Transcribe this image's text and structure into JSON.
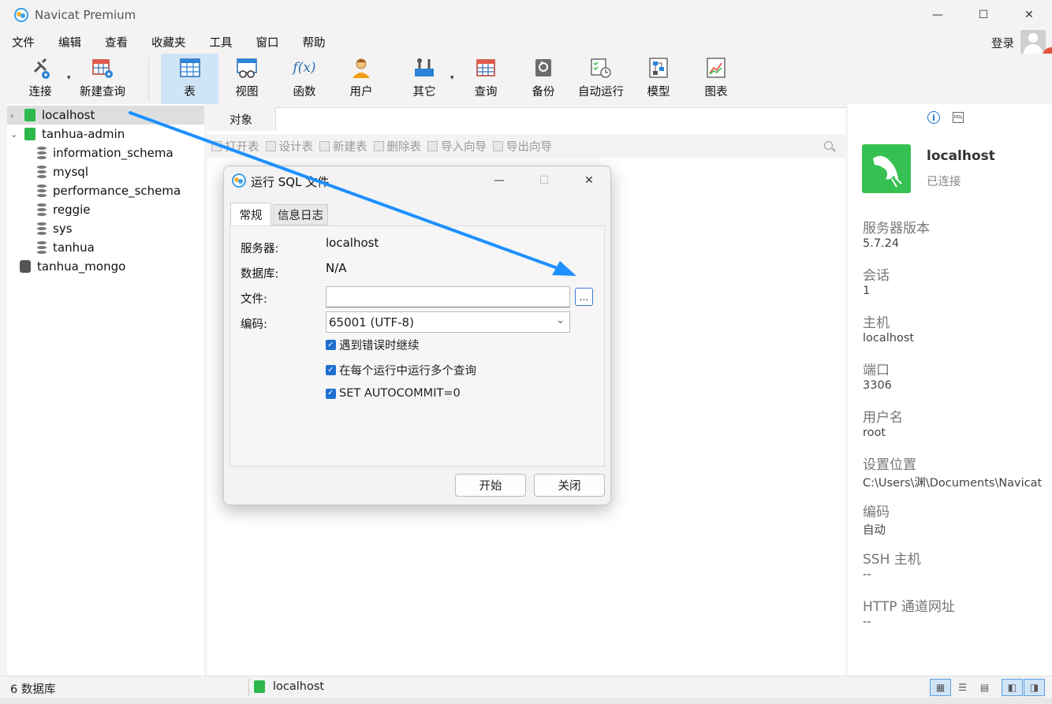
{
  "app": {
    "title": "Navicat Premium"
  },
  "window_controls": {
    "minimize": "—",
    "maximize": "☐",
    "close": "✕"
  },
  "menu": [
    "文件",
    "编辑",
    "查看",
    "收藏夹",
    "工具",
    "窗口",
    "帮助"
  ],
  "login_label": "登录",
  "toolbar": [
    {
      "label": "连接",
      "icon": "connection-plug-icon"
    },
    {
      "label": "新建查询",
      "icon": "new-query-icon"
    },
    {
      "label": "表",
      "icon": "table-icon",
      "active": true
    },
    {
      "label": "视图",
      "icon": "view-icon"
    },
    {
      "label": "函数",
      "icon": "function-icon",
      "glyph": "f(x)"
    },
    {
      "label": "用户",
      "icon": "user-icon"
    },
    {
      "label": "其它",
      "icon": "tools-icon"
    },
    {
      "label": "查询",
      "icon": "query-icon"
    },
    {
      "label": "备份",
      "icon": "backup-icon"
    },
    {
      "label": "自动运行",
      "icon": "automation-icon"
    },
    {
      "label": "模型",
      "icon": "model-icon"
    },
    {
      "label": "图表",
      "icon": "chart-icon"
    }
  ],
  "sidebar": {
    "items": [
      {
        "label": "localhost",
        "type": "connection",
        "expanded": false,
        "selected": true
      },
      {
        "label": "tanhua-admin",
        "type": "connection",
        "expanded": true
      },
      {
        "label": "information_schema",
        "type": "database"
      },
      {
        "label": "mysql",
        "type": "database"
      },
      {
        "label": "performance_schema",
        "type": "database"
      },
      {
        "label": "reggie",
        "type": "database"
      },
      {
        "label": "sys",
        "type": "database"
      },
      {
        "label": "tanhua",
        "type": "database"
      },
      {
        "label": "tanhua_mongo",
        "type": "mongo-connection"
      }
    ]
  },
  "main": {
    "tab_label": "对象",
    "object_toolbar": [
      "打开表",
      "设计表",
      "新建表",
      "删除表",
      "导入向导",
      "导出向导"
    ]
  },
  "info_panel": {
    "ddl_tab": "DDL",
    "name": "localhost",
    "status": "已连接",
    "properties": [
      {
        "label": "服务器版本",
        "value": "5.7.24"
      },
      {
        "label": "会话",
        "value": "1"
      },
      {
        "label": "主机",
        "value": "localhost"
      },
      {
        "label": "端口",
        "value": "3306"
      },
      {
        "label": "用户名",
        "value": "root"
      },
      {
        "label": "设置位置",
        "value": "C:\\Users\\渊\\Documents\\Navicat"
      },
      {
        "label": "编码",
        "value": "自动"
      },
      {
        "label": "SSH 主机",
        "value": "--"
      },
      {
        "label": "HTTP 通道网址",
        "value": "--"
      }
    ]
  },
  "dialog": {
    "title": "运行 SQL 文件",
    "tabs": [
      "常规",
      "信息日志"
    ],
    "server_label": "服务器:",
    "server_value": "localhost",
    "database_label": "数据库:",
    "database_value": "N/A",
    "file_label": "文件:",
    "file_value": "",
    "browse_label": "...",
    "encoding_label": "编码:",
    "encoding_value": "65001 (UTF-8)",
    "options": [
      {
        "label": "遇到错误时继续",
        "checked": true
      },
      {
        "label": "在每个运行中运行多个查询",
        "checked": true
      },
      {
        "label": "SET AUTOCOMMIT=0",
        "checked": true
      }
    ],
    "start_button": "开始",
    "close_button": "关闭"
  },
  "statusbar": {
    "db_count": "6 数据库",
    "connection": "localhost"
  },
  "colors": {
    "accent": "#1e6fd0",
    "connection_green": "#2db84b",
    "arrow_blue": "#1e90ff",
    "active_toolbar": "#cfe4f7"
  }
}
